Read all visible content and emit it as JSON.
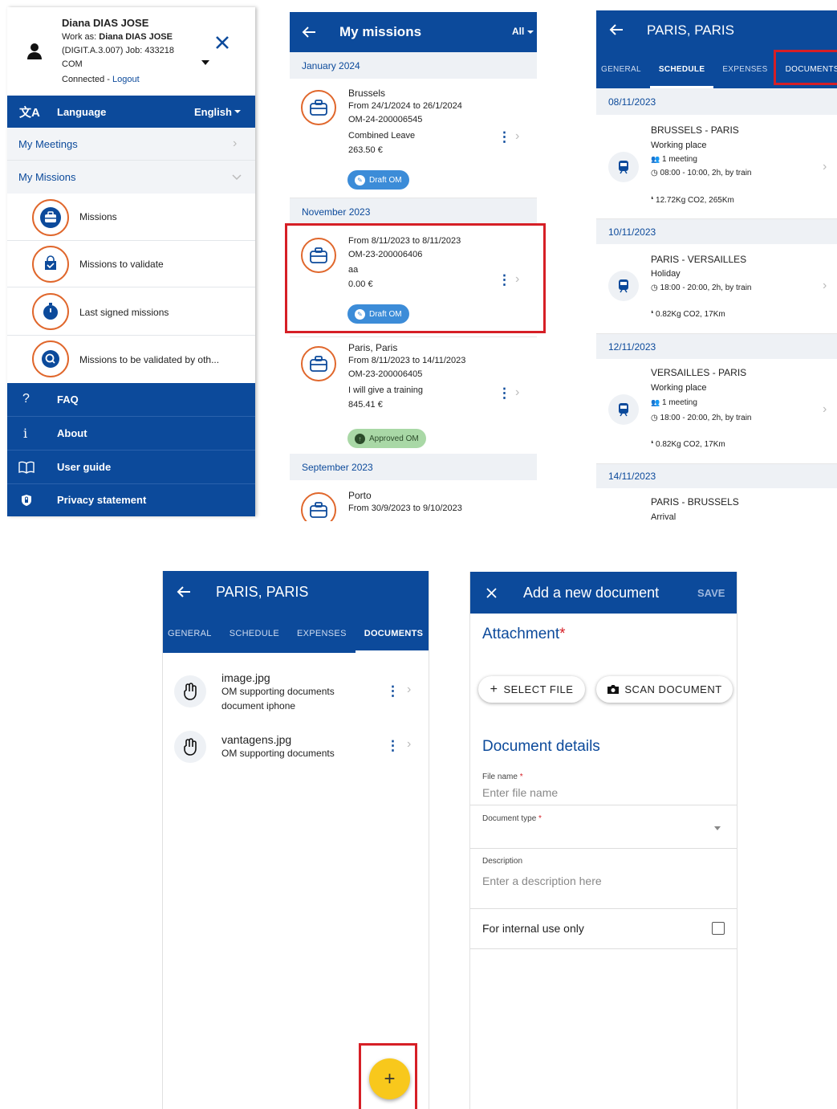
{
  "menu": {
    "user_name": "Diana DIAS JOSE",
    "work_as_label": "Work as:",
    "work_as_name": "Diana DIAS JOSE",
    "work_as_detail": "(DIGIT.A.3.007) Job: 433218",
    "dg": "COM",
    "connected": "Connected",
    "logout": "Logout",
    "language_label": "Language",
    "language_value": "English",
    "my_meetings": "My Meetings",
    "my_missions": "My Missions",
    "sub": [
      "Missions",
      "Missions to validate",
      "Last signed missions",
      "Missions to be validated by oth..."
    ],
    "faq": "FAQ",
    "about": "About",
    "user_guide": "User guide",
    "privacy": "Privacy statement"
  },
  "missions": {
    "title": "My missions",
    "filter": "All",
    "sections": [
      "January 2024",
      "November 2023",
      "September 2023"
    ],
    "items": [
      {
        "title": "Brussels",
        "dates": "From 24/1/2024 to 26/1/2024",
        "om": "OM-24-200006545",
        "desc": "Combined Leave",
        "amount": "263.50 €",
        "status": "Draft OM"
      },
      {
        "title": "",
        "dates": "From 8/11/2023 to 8/11/2023",
        "om": "OM-23-200006406",
        "desc": "aa",
        "amount": "0.00 €",
        "status": "Draft OM"
      },
      {
        "title": "Paris, Paris",
        "dates": "From 8/11/2023 to 14/11/2023",
        "om": "OM-23-200006405",
        "desc": "I will give a training",
        "amount": "845.41 €",
        "status": "Approved OM"
      },
      {
        "title": "Porto",
        "dates": "From 30/9/2023 to 9/10/2023"
      }
    ]
  },
  "schedule": {
    "title": "PARIS, PARIS",
    "tabs": [
      "GENERAL",
      "SCHEDULE",
      "EXPENSES",
      "DOCUMENTS"
    ],
    "dates": [
      "08/11/2023",
      "10/11/2023",
      "12/11/2023",
      "14/11/2023"
    ],
    "items": [
      {
        "route": "BRUSSELS - PARIS",
        "type": "Working place",
        "meeting": "1 meeting",
        "time": "08:00 - 10:00, 2h, by train",
        "co2": "12.72Kg CO2, 265Km"
      },
      {
        "route": "PARIS - VERSAILLES",
        "type": "Holiday",
        "time": "18:00 - 20:00, 2h, by train",
        "co2": "0.82Kg CO2, 17Km"
      },
      {
        "route": "VERSAILLES - PARIS",
        "type": "Working place",
        "meeting": "1 meeting",
        "time": "18:00 - 20:00, 2h, by train",
        "co2": "0.82Kg CO2, 17Km"
      },
      {
        "route": "PARIS - BRUSSELS",
        "type": "Arrival"
      }
    ]
  },
  "documents": {
    "title": "PARIS, PARIS",
    "tabs": [
      "GENERAL",
      "SCHEDULE",
      "EXPENSES",
      "DOCUMENTS"
    ],
    "items": [
      {
        "name": "image.jpg",
        "category": "OM supporting documents",
        "note": "document iphone"
      },
      {
        "name": "vantagens.jpg",
        "category": "OM supporting documents"
      }
    ],
    "fab": "+"
  },
  "add_document": {
    "title": "Add a new document",
    "save": "SAVE",
    "attachment": "Attachment",
    "select_file": "SELECT FILE",
    "scan_document": "SCAN DOCUMENT",
    "details": "Document details",
    "file_name_label": "File name",
    "file_name_placeholder": "Enter file name",
    "doc_type_label": "Document type",
    "description_label": "Description",
    "description_placeholder": "Enter a description here",
    "internal_label": "For internal use only"
  }
}
